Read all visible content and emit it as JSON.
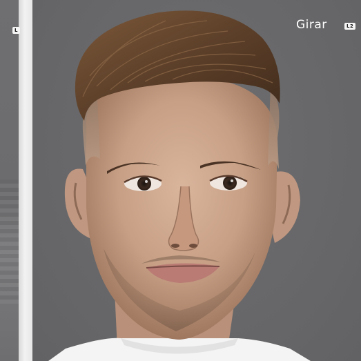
{
  "hud": {
    "left_button": "L",
    "camera_action": "Girar",
    "right_button": "L2"
  },
  "scene": {
    "subject_icon": "player-face-icon",
    "shirt_color": "#f4f4f4",
    "background_color": "#69696b",
    "hair_color": "#6a4a32",
    "skin_color": "#caa48c"
  }
}
